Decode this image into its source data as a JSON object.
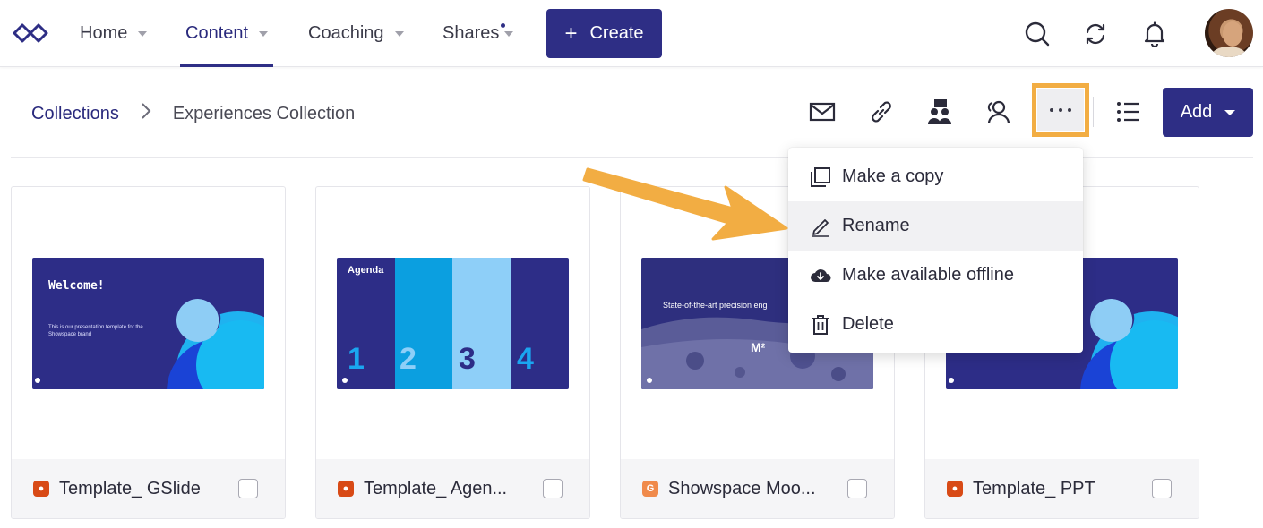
{
  "nav": {
    "items": [
      {
        "label": "Home"
      },
      {
        "label": "Content"
      },
      {
        "label": "Coaching"
      },
      {
        "label": "Shares"
      }
    ],
    "create_label": "Create"
  },
  "breadcrumb": {
    "root": "Collections",
    "current": "Experiences Collection"
  },
  "toolbar": {
    "add_label": "Add"
  },
  "menu": {
    "items": [
      {
        "label": "Make a copy",
        "icon": "copy-icon"
      },
      {
        "label": "Rename",
        "icon": "pencil-icon"
      },
      {
        "label": "Make available offline",
        "icon": "cloud-download-icon"
      },
      {
        "label": "Delete",
        "icon": "trash-icon"
      }
    ]
  },
  "cards": [
    {
      "name": "Template_ GSlide",
      "type_color": "#d84a16",
      "slide_title": "Welcome!",
      "slide_body": "This is our presentation template for the Showspace brand"
    },
    {
      "name": "Template_ Agen...",
      "type_color": "#d84a16",
      "slide_title": "Agenda",
      "numbers": [
        "1",
        "2",
        "3",
        "4"
      ]
    },
    {
      "name": "Showspace Moo...",
      "type_color": "#f08a4b",
      "type_letter": "G",
      "slide_title": "State-of-the-art precision eng",
      "slide_mark": "M²"
    },
    {
      "name": "Template_ PPT",
      "type_color": "#d84a16"
    }
  ],
  "colors": {
    "brand": "#2e2e85",
    "highlight": "#f2ad43"
  }
}
